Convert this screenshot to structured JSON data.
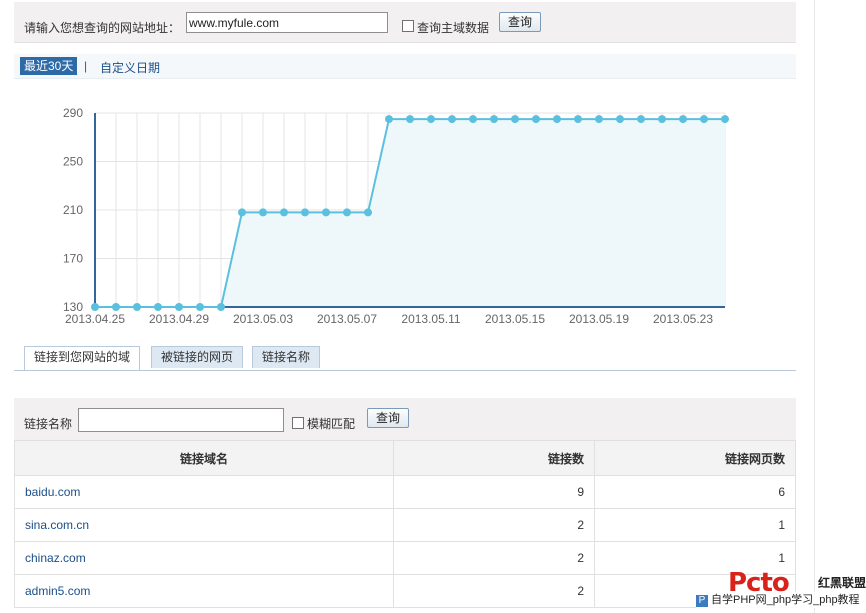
{
  "search": {
    "label": "请输入您想查询的网站地址：",
    "url_value": "www.myfule.com",
    "main_domain_label": "查询主域数据",
    "button_label": "查询"
  },
  "range": {
    "active_label": "最近30天",
    "separator": "|",
    "custom_label": "自定义日期"
  },
  "chart_data": {
    "type": "area",
    "x": [
      "2013.04.25",
      "2013.04.26",
      "2013.04.27",
      "2013.04.28",
      "2013.04.29",
      "2013.04.30",
      "2013.05.01",
      "2013.05.02",
      "2013.05.03",
      "2013.05.04",
      "2013.05.05",
      "2013.05.06",
      "2013.05.07",
      "2013.05.08",
      "2013.05.09",
      "2013.05.10",
      "2013.05.11",
      "2013.05.12",
      "2013.05.13",
      "2013.05.14",
      "2013.05.15",
      "2013.05.16",
      "2013.05.17",
      "2013.05.18",
      "2013.05.19",
      "2013.05.20",
      "2013.05.21",
      "2013.05.22",
      "2013.05.23",
      "2013.05.24",
      "2013.05.25"
    ],
    "series": [
      {
        "values": [
          130,
          130,
          130,
          130,
          130,
          130,
          130,
          208,
          208,
          208,
          208,
          208,
          208,
          208,
          285,
          285,
          285,
          285,
          285,
          285,
          285,
          285,
          285,
          285,
          285,
          285,
          285,
          285,
          285,
          285,
          285
        ]
      }
    ],
    "x_tick_labels": [
      "2013.04.25",
      "2013.04.29",
      "2013.05.03",
      "2013.05.07",
      "2013.05.11",
      "2013.05.15",
      "2013.05.19",
      "2013.05.23"
    ],
    "y_tick_labels": [
      "290",
      "250",
      "210",
      "170",
      "130"
    ],
    "y_ticks": [
      290,
      250,
      210,
      170,
      130
    ],
    "ylim": [
      130,
      290
    ],
    "grid": true,
    "line_color": "#5bc0de",
    "fill_color": "#eef8fb"
  },
  "tabs": [
    {
      "label": "链接到您网站的域"
    },
    {
      "label": "被链接的网页"
    },
    {
      "label": "链接名称"
    }
  ],
  "filter": {
    "label": "链接名称",
    "value": "",
    "fuzzy_label": "模糊匹配",
    "button_label": "查询"
  },
  "table": {
    "headers": [
      "链接域名",
      "链接数",
      "链接网页数"
    ],
    "rows": [
      {
        "domain": "baidu.com",
        "links": "9",
        "pages": "6"
      },
      {
        "domain": "sina.com.cn",
        "links": "2",
        "pages": "1"
      },
      {
        "domain": "chinaz.com",
        "links": "2",
        "pages": "1"
      },
      {
        "domain": "admin5.com",
        "links": "2",
        "pages": ""
      }
    ]
  },
  "watermark": {
    "logo": "Pcto",
    "brand": "红黑联盟",
    "icon_letter": "P",
    "line": "自学PHP网_php学习_php教程"
  }
}
